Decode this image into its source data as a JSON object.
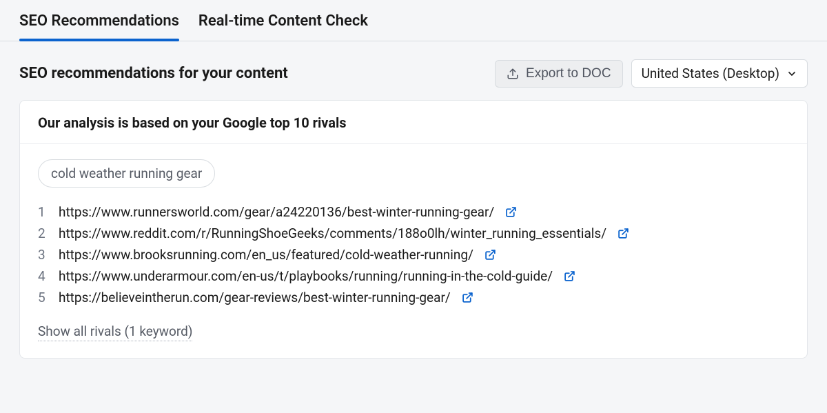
{
  "tabs": {
    "seo": "SEO Recommendations",
    "realtime": "Real-time Content Check"
  },
  "header": {
    "title": "SEO recommendations for your content",
    "export_label": "Export to DOC",
    "region": "United States (Desktop)"
  },
  "card": {
    "title": "Our analysis is based on your Google top 10 rivals",
    "keyword": "cold weather running gear",
    "rivals": [
      {
        "index": "1",
        "url": "https://www.runnersworld.com/gear/a24220136/best-winter-running-gear/"
      },
      {
        "index": "2",
        "url": "https://www.reddit.com/r/RunningShoeGeeks/comments/188o0lh/winter_running_essentials/"
      },
      {
        "index": "3",
        "url": "https://www.brooksrunning.com/en_us/featured/cold-weather-running/"
      },
      {
        "index": "4",
        "url": "https://www.underarmour.com/en-us/t/playbooks/running/running-in-the-cold-guide/"
      },
      {
        "index": "5",
        "url": "https://believeintherun.com/gear-reviews/best-winter-running-gear/"
      }
    ],
    "show_all": "Show all rivals (1 keyword)"
  }
}
